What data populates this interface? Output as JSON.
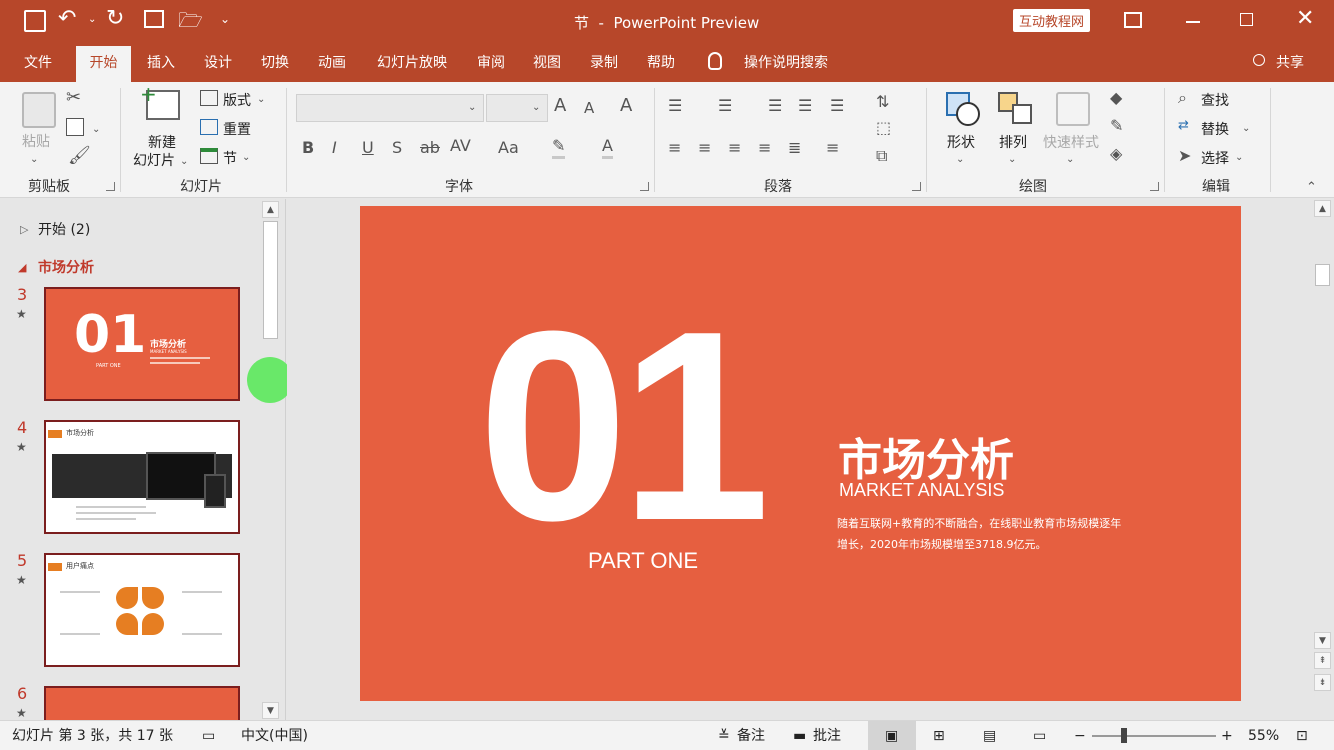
{
  "title": {
    "doc_title": "节  -  PowerPoint Preview",
    "badge": "互动教程网"
  },
  "tabs": [
    "文件",
    "开始",
    "插入",
    "设计",
    "切换",
    "动画",
    "幻灯片放映",
    "审阅",
    "视图",
    "录制",
    "帮助",
    "操作说明搜索",
    "共享"
  ],
  "ribbon": {
    "clipboard": {
      "paste": "粘贴",
      "group": "剪贴板"
    },
    "slides": {
      "new_slide_1": "新建",
      "new_slide_2": "幻灯片",
      "layout": "版式",
      "reset": "重置",
      "section": "节",
      "group": "幻灯片"
    },
    "font": {
      "group": "字体"
    },
    "paragraph": {
      "group": "段落"
    },
    "drawing": {
      "shapes": "形状",
      "arrange": "排列",
      "quick_styles": "快速样式",
      "group": "绘图"
    },
    "editing": {
      "find": "查找",
      "replace": "替换",
      "select": "选择",
      "group": "编辑"
    }
  },
  "thumbnails": {
    "section1": "开始 (2)",
    "section2": "市场分析",
    "slides": [
      {
        "num": "3",
        "big": "01",
        "title": "市场分析",
        "sub": "MARKET ANALYSIS",
        "part": "PART ONE"
      },
      {
        "num": "4",
        "title": "市场分析"
      },
      {
        "num": "5",
        "title": "用户痛点"
      },
      {
        "num": "6"
      }
    ]
  },
  "click_marker": "13",
  "slide": {
    "big_number": "01",
    "title": "市场分析",
    "subtitle": "MARKET ANALYSIS",
    "body_line1": "随着互联网+教育的不断融合，在线职业教育市场规模逐年",
    "body_line2": "增长，2020年市场规模增至3718.9亿元。",
    "part": "PART ONE"
  },
  "status": {
    "slide_info": "幻灯片 第 3 张，共 17 张",
    "language": "中文(中国)",
    "notes": "备注",
    "comments": "批注",
    "zoom": "55%"
  },
  "colors": {
    "accent": "#b7472a",
    "slide_bg": "#e65f40",
    "marker": "#5ee85e"
  }
}
